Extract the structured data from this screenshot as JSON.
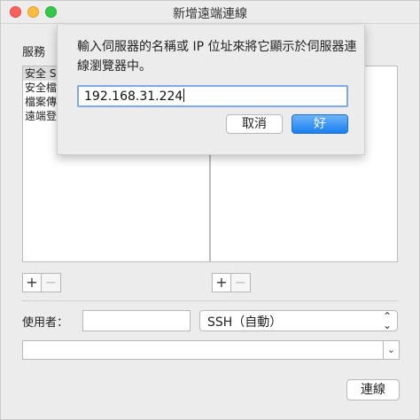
{
  "window": {
    "title": "新增遠端連線"
  },
  "services": {
    "label": "服務",
    "items": [
      {
        "label": "安全 S",
        "selected": true
      },
      {
        "label": "安全檔"
      },
      {
        "label": "檔案傳"
      },
      {
        "label": "遠端登"
      }
    ],
    "add_label": "+",
    "remove_label": "−"
  },
  "servers": {
    "add_label": "+",
    "remove_label": "−"
  },
  "user": {
    "label": "使用者：",
    "value": "",
    "protocol": "SSH（自動）"
  },
  "command": {
    "value": "",
    "dropdown_glyph": "⌄"
  },
  "connect_label": "連線",
  "sheet": {
    "message": "輸入伺服器的名稱或 IP 位址來將它顯示於伺服器連線瀏覽器中。",
    "input_value": "192.168.31.224",
    "cancel_label": "取消",
    "ok_label": "好"
  },
  "colors": {
    "accent": "#1b7ff0",
    "close": "#fc605c",
    "minimize": "#fdbc40",
    "maximize": "#34c84a"
  }
}
